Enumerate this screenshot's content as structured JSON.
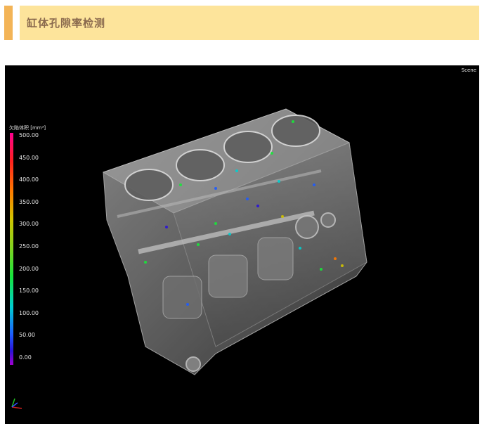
{
  "header": {
    "title": "缸体孔隙率检测"
  },
  "viewport": {
    "scene_label": "Scene",
    "legend": {
      "title": "欠陷体积 [mm³]",
      "values": [
        "500.00",
        "450.00",
        "400.00",
        "350.00",
        "300.00",
        "250.00",
        "200.00",
        "150.00",
        "100.00",
        "50.00",
        "0.00"
      ]
    },
    "model_icon": "engine-block-ct-render",
    "axes_icon": "xyz-axis-triad-icon"
  },
  "colors": {
    "header_accent": "#f3b457",
    "header_bar": "#fde49b",
    "header_text": "#8a6a4e",
    "viewport_bg": "#000000"
  }
}
